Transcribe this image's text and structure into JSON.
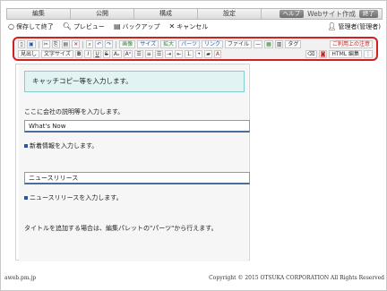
{
  "menu": {
    "tabs": [
      "編集",
      "公開",
      "構成",
      "設定"
    ],
    "help": "ヘルプ",
    "site_title": "Webサイト作成",
    "exit": "終了"
  },
  "toolbar2": {
    "save_exit": "保存して終了",
    "preview": "プレビュー",
    "backup": "バックアップ",
    "cancel": "キャンセル",
    "admin": "管理者(管理者)"
  },
  "editor_toolbar": {
    "row1": {
      "image": "画像",
      "size": "サイズ",
      "enlarge": "拡大",
      "parts": "パーツ",
      "link": "リンク",
      "file": "ファイル",
      "tag": "タグ",
      "notice": "ご利用上の注意"
    },
    "row2": {
      "heading": "見出し",
      "font_size": "文字サイズ",
      "html_edit": "HTML 編集"
    }
  },
  "content": {
    "catch_copy": "キャッチコピー等を入力します。",
    "description": "ここに会社の説明等を入力します。",
    "section1_title": "What's Now",
    "section1_item": "新着情報を入力します。",
    "section2_title": "ニュースリリース",
    "section2_item": "ニュースリリースを入力します。",
    "note": "タイトルを追加する場合は、編集パレットの\"パーツ\"から行えます。"
  },
  "footer": {
    "domain": "aweb.pm.jp",
    "copyright": "Copyright © 2015 OTSUKA CORPORATION All Rights Reserved"
  }
}
